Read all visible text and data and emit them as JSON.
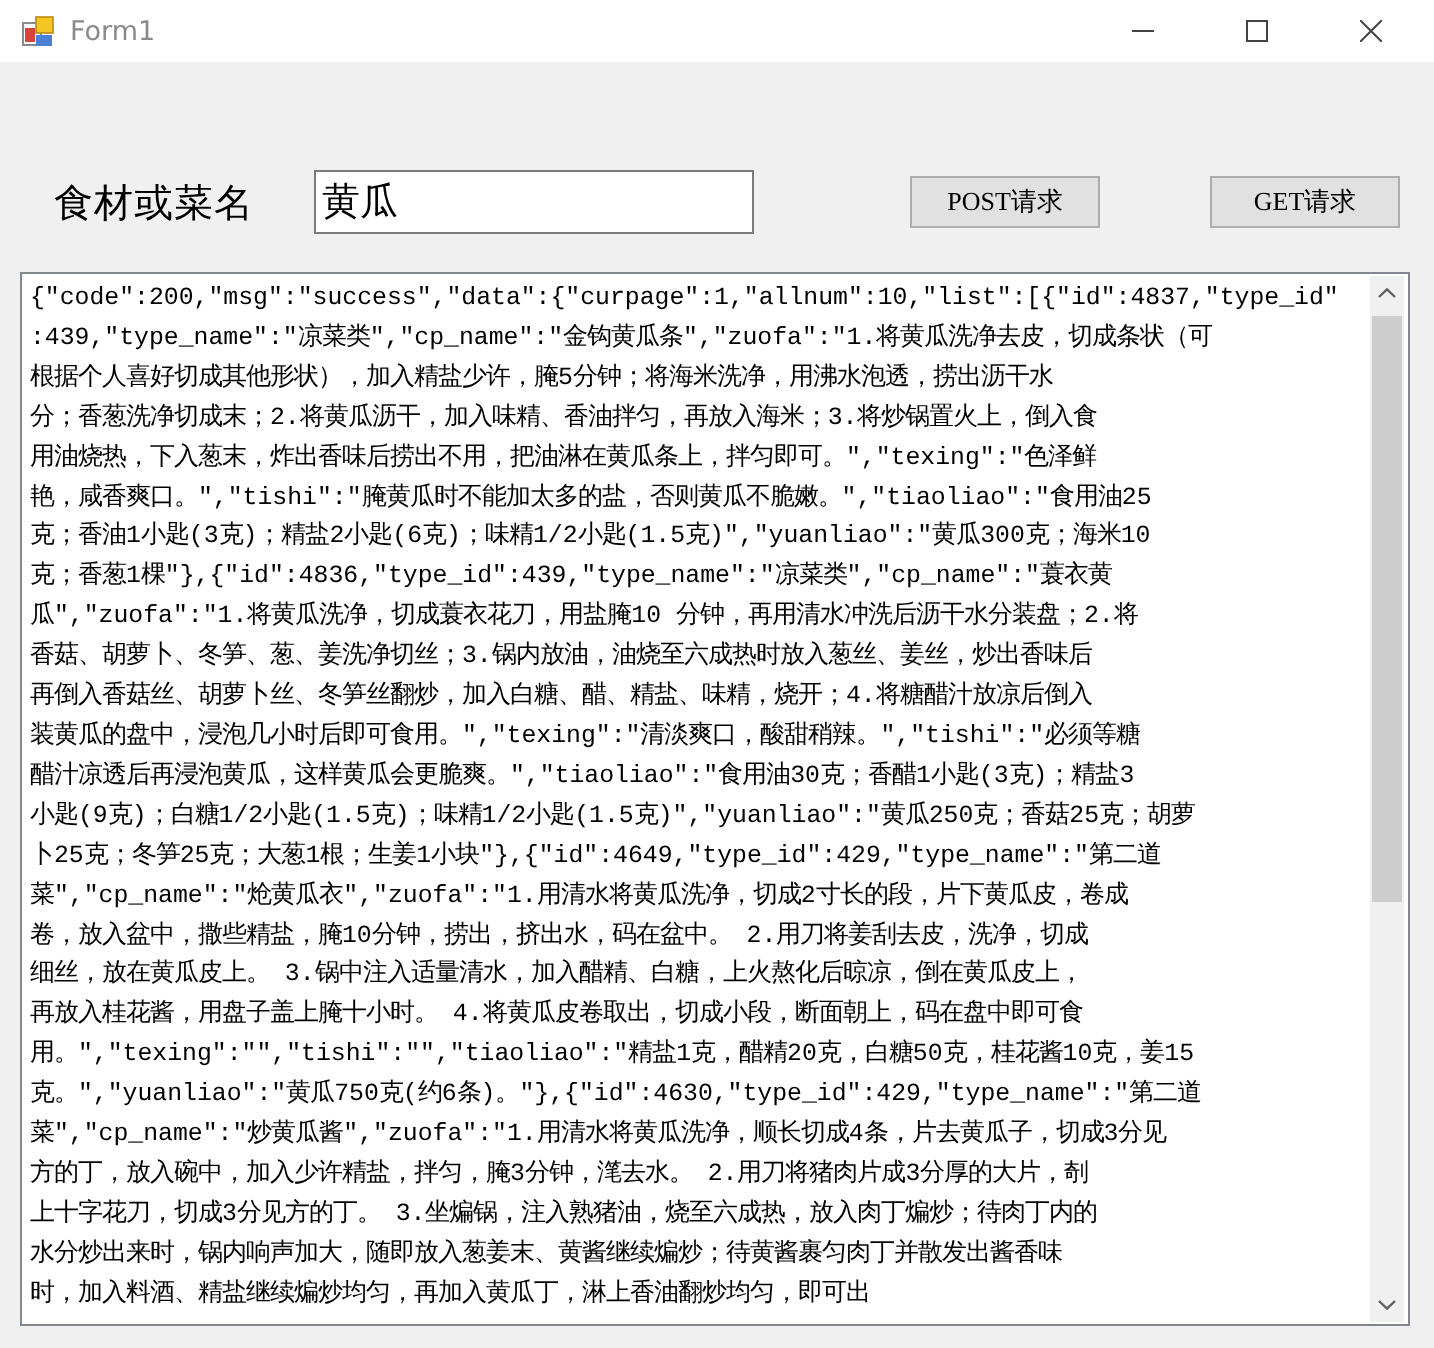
{
  "window": {
    "title": "Form1"
  },
  "search": {
    "label": "食材或菜名",
    "value": "黄瓜"
  },
  "buttons": [
    "POST请求",
    "GET请求"
  ],
  "response": {
    "lines": [
      "{\"code\":200,\"msg\":\"success\",\"data\":{\"curpage\":1,\"allnum\":10,\"list\":[{\"id\":4837,\"type_id\"",
      ":439,\"type_name\":\"凉菜类\",\"cp_name\":\"金钩黄瓜条\",\"zuofa\":\"1.将黄瓜洗净去皮，切成条状（可",
      "根据个人喜好切成其他形状），加入精盐少许，腌5分钟；将海米洗净，用沸水泡透，捞出沥干水",
      "分；香葱洗净切成末；2.将黄瓜沥干，加入味精、香油拌匀，再放入海米；3.将炒锅置火上，倒入食",
      "用油烧热，下入葱末，炸出香味后捞出不用，把油淋在黄瓜条上，拌匀即可。\",\"texing\":\"色泽鲜",
      "艳，咸香爽口。\",\"tishi\":\"腌黄瓜时不能加太多的盐，否则黄瓜不脆嫩。\",\"tiaoliao\":\"食用油25",
      "克；香油1小匙(3克)；精盐2小匙(6克)；味精1/2小匙(1.5克)\",\"yuanliao\":\"黄瓜300克；海米10",
      "克；香葱1棵\"},{\"id\":4836,\"type_id\":439,\"type_name\":\"凉菜类\",\"cp_name\":\"蓑衣黄",
      "瓜\",\"zuofa\":\"1.将黄瓜洗净，切成蓑衣花刀，用盐腌10 分钟，再用清水冲洗后沥干水分装盘；2.将",
      "香菇、胡萝卜、冬笋、葱、姜洗净切丝；3.锅内放油，油烧至六成热时放入葱丝、姜丝，炒出香味后",
      "再倒入香菇丝、胡萝卜丝、冬笋丝翻炒，加入白糖、醋、精盐、味精，烧开；4.将糖醋汁放凉后倒入",
      "装黄瓜的盘中，浸泡几小时后即可食用。\",\"texing\":\"清淡爽口，酸甜稍辣。\",\"tishi\":\"必须等糖",
      "醋汁凉透后再浸泡黄瓜，这样黄瓜会更脆爽。\",\"tiaoliao\":\"食用油30克；香醋1小匙(3克)；精盐3",
      "小匙(9克)；白糖1/2小匙(1.5克)；味精1/2小匙(1.5克)\",\"yuanliao\":\"黄瓜250克；香菇25克；胡萝",
      "卜25克；冬笋25克；大葱1根；生姜1小块\"},{\"id\":4649,\"type_id\":429,\"type_name\":\"第二道",
      "菜\",\"cp_name\":\"炝黄瓜衣\",\"zuofa\":\"1.用清水将黄瓜洗净，切成2寸长的段，片下黄瓜皮，卷成",
      "卷，放入盆中，撒些精盐，腌10分钟，捞出，挤出水，码在盆中。 2.用刀将姜刮去皮，洗净，切成",
      "细丝，放在黄瓜皮上。 3.锅中注入适量清水，加入醋精、白糖，上火熬化后晾凉，倒在黄瓜皮上，",
      "再放入桂花酱，用盘子盖上腌十小时。 4.将黄瓜皮卷取出，切成小段，断面朝上，码在盘中即可食",
      "用。\",\"texing\":\"\",\"tishi\":\"\",\"tiaoliao\":\"精盐1克，醋精20克，白糖50克，桂花酱10克，姜15",
      "克。\",\"yuanliao\":\"黄瓜750克(约6条)。\"},{\"id\":4630,\"type_id\":429,\"type_name\":\"第二道",
      "菜\",\"cp_name\":\"炒黄瓜酱\",\"zuofa\":\"1.用清水将黄瓜洗净，顺长切成4条，片去黄瓜子，切成3分见",
      "方的丁，放入碗中，加入少许精盐，拌匀，腌3分钟，滗去水。 2.用刀将猪肉片成3分厚的大片，剞",
      "上十字花刀，切成3分见方的丁。 3.坐煸锅，注入熟猪油，烧至六成热，放入肉丁煸炒；待肉丁内的",
      "水分炒出来时，锅内响声加大，随即放入葱姜末、黄酱继续煸炒；待黄酱裹匀肉丁并散发出酱香味",
      "时，加入料酒、精盐继续煸炒均匀，再加入黄瓜丁，淋上香油翻炒均匀，即可出"
    ]
  }
}
